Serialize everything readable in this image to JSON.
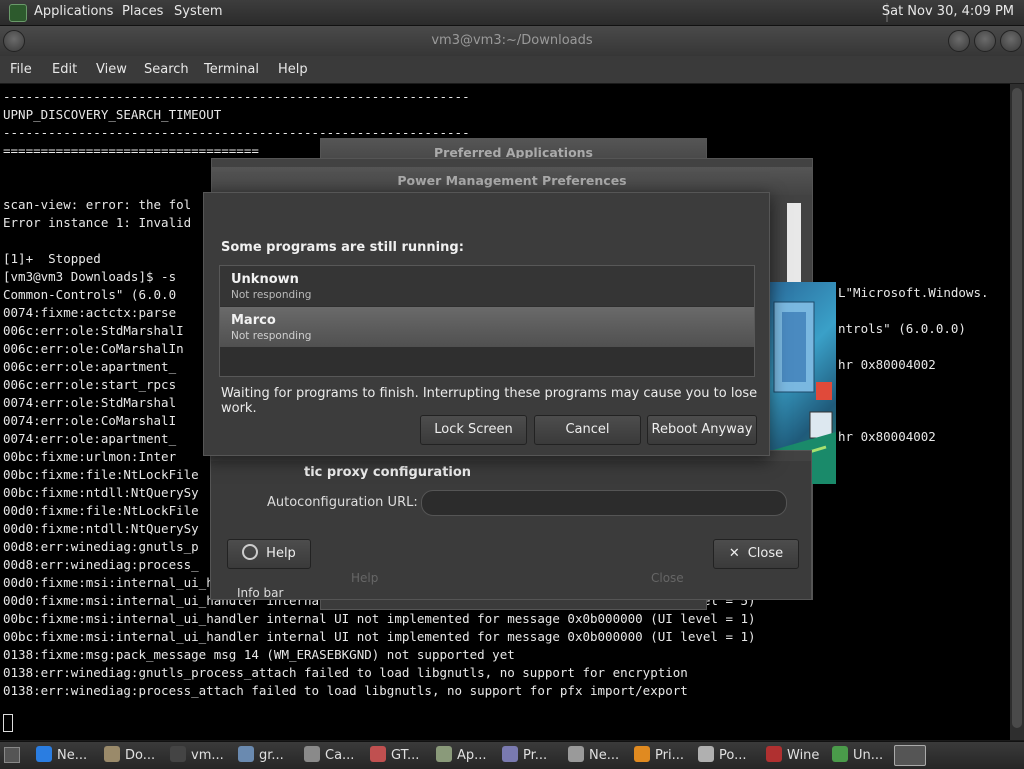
{
  "top_panel": {
    "menus": [
      "Applications",
      "Places",
      "System"
    ],
    "clock": "Sat Nov 30,  4:09 PM"
  },
  "terminal": {
    "title": "vm3@vm3:~/Downloads",
    "menubar": [
      "File",
      "Edit",
      "View",
      "Search",
      "Terminal",
      "Help"
    ],
    "lines": [
      "--------------------------------------------------------------",
      "UPNP_DISCOVERY_SEARCH_TIMEOUT",
      "--------------------------------------------------------------",
      "==================================",
      "",
      "",
      "scan-view: error: the fol",
      "Error instance 1: Invalid",
      "",
      "[1]+  Stopped",
      "[vm3@vm3 Downloads]$ -s",
      "Common-Controls\" (6.0.0",
      "0074:fixme:actctx:parse",
      "006c:err:ole:StdMarshalI",
      "006c:err:ole:CoMarshalIn",
      "006c:err:ole:apartment_",
      "006c:err:ole:start_rpcs",
      "0074:err:ole:StdMarshal",
      "0074:err:ole:CoMarshalI",
      "0074:err:ole:apartment_",
      "00bc:fixme:urlmon:Inter",
      "00bc:fixme:file:NtLockFile",
      "00bc:fixme:ntdll:NtQuerySy",
      "00d0:fixme:file:NtLockFile",
      "00d0:fixme:ntdll:NtQuerySy",
      "00d8:err:winediag:gnutls_p",
      "00d8:err:winediag:process_",
      "00d0:fixme:msi:internal_ui_handler internal UI not implemented for message 0x0b000000 (UI level = 5)",
      "00d0:fixme:msi:internal_ui_handler internal UI not implemented for message 0x0b000000 (UI level = 5)",
      "00bc:fixme:msi:internal_ui_handler internal UI not implemented for message 0x0b000000 (UI level = 1)",
      "00bc:fixme:msi:internal_ui_handler internal UI not implemented for message 0x0b000000 (UI level = 1)",
      "0138:fixme:msg:pack_message msg 14 (WM_ERASEBKGND) not supported yet",
      "0138:err:winediag:gnutls_process_attach failed to load libgnutls, no support for encryption",
      "0138:err:winediag:process_attach failed to load libgnutls, no support for pfx import/export"
    ],
    "right_fragments": [
      "L\"Microsoft.Windows.",
      "ntrols\" (6.0.0.0)",
      "hr 0x80004002",
      "hr 0x80004002"
    ]
  },
  "bg_dialogs": {
    "preferred_title": "Preferred Applications",
    "power_title": "Power Management Preferences",
    "proxy_section": "tic proxy configuration",
    "autoconfig_label": "Autoconfiguration URL:",
    "help_label": "Help",
    "close_label": "Close",
    "infobar_label": "Info bar",
    "ghost_help": "Help",
    "ghost_close": "Close"
  },
  "dialog": {
    "heading": "Some programs are still running:",
    "programs": [
      {
        "name": "Unknown",
        "status": "Not responding"
      },
      {
        "name": "Marco",
        "status": "Not responding"
      }
    ],
    "message": "Waiting for programs to finish.  Interrupting these programs may cause you to lose work.",
    "buttons": {
      "lock": "Lock Screen",
      "cancel": "Cancel",
      "reboot": "Reboot Anyway"
    }
  },
  "taskbar": {
    "items": [
      {
        "label": "Ne...",
        "color": "#2a7de1"
      },
      {
        "label": "Do...",
        "color": "#9a8a6a"
      },
      {
        "label": "vm...",
        "color": "#444444"
      },
      {
        "label": "gr...",
        "color": "#6a8ab0"
      },
      {
        "label": "Ca...",
        "color": "#8a8a8a"
      },
      {
        "label": "GT...",
        "color": "#c05050"
      },
      {
        "label": "Ap...",
        "color": "#8a9a7a"
      },
      {
        "label": "Pr...",
        "color": "#7a7ab0"
      },
      {
        "label": "Ne...",
        "color": "#9a9a9a"
      },
      {
        "label": "Pri...",
        "color": "#e08a20"
      },
      {
        "label": "Po...",
        "color": "#b0b0b0"
      },
      {
        "label": "Wine",
        "color": "#b03030"
      },
      {
        "label": "Un...",
        "color": "#4a9a4a"
      }
    ]
  }
}
